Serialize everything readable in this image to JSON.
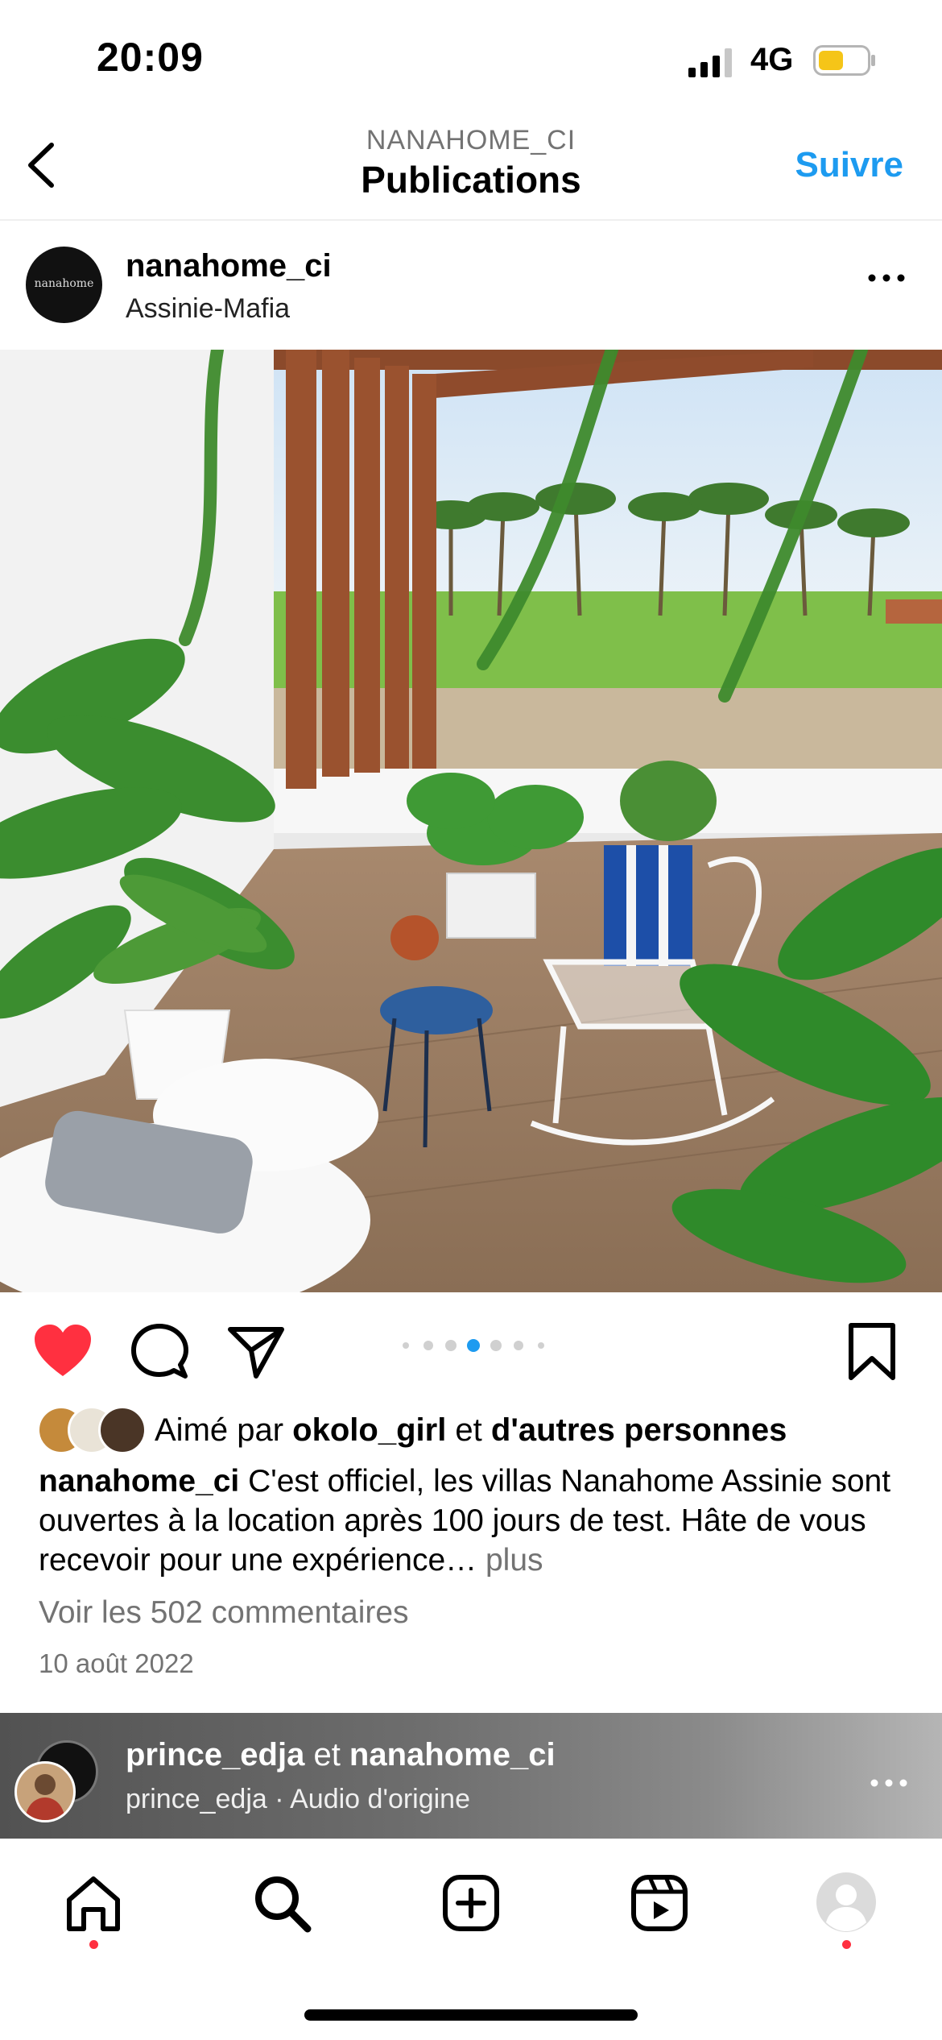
{
  "status_bar": {
    "time": "20:09",
    "network": "4G",
    "battery_color": "#f5c518"
  },
  "nav": {
    "account": "NANAHOME_CI",
    "title": "Publications",
    "follow_label": "Suivre"
  },
  "post": {
    "username": "nanahome_ci",
    "location": "Assinie-Mafia",
    "avatar_text": "nanahome",
    "carousel": {
      "count": 7,
      "active_index": 3
    },
    "liked": true,
    "likes": {
      "prefix": "Aimé par ",
      "user": "okolo_girl",
      "middle": " et ",
      "others": "d'autres personnes"
    },
    "caption": {
      "username": "nanahome_ci",
      "text": " C'est officiel, les villas Nanahome Assinie sont ouvertes à la location après 100 jours de test. Hâte de vous recevoir pour une expérience…",
      "more": " plus"
    },
    "comments_link": "Voir les 502 commentaires",
    "date": "10 août 2022"
  },
  "next_post": {
    "user1": "prince_edja",
    "connector": " et ",
    "user2": "nanahome_ci",
    "audio": "prince_edja · Audio d'origine"
  },
  "tabs": [
    {
      "name": "home-icon",
      "notification": true
    },
    {
      "name": "search-icon",
      "notification": false
    },
    {
      "name": "new-post-icon",
      "notification": false
    },
    {
      "name": "reels-icon",
      "notification": false
    },
    {
      "name": "profile-icon",
      "notification": true
    }
  ],
  "colors": {
    "accent": "#1d9bf0",
    "like": "#ff3040",
    "secondary_text": "#737373"
  }
}
